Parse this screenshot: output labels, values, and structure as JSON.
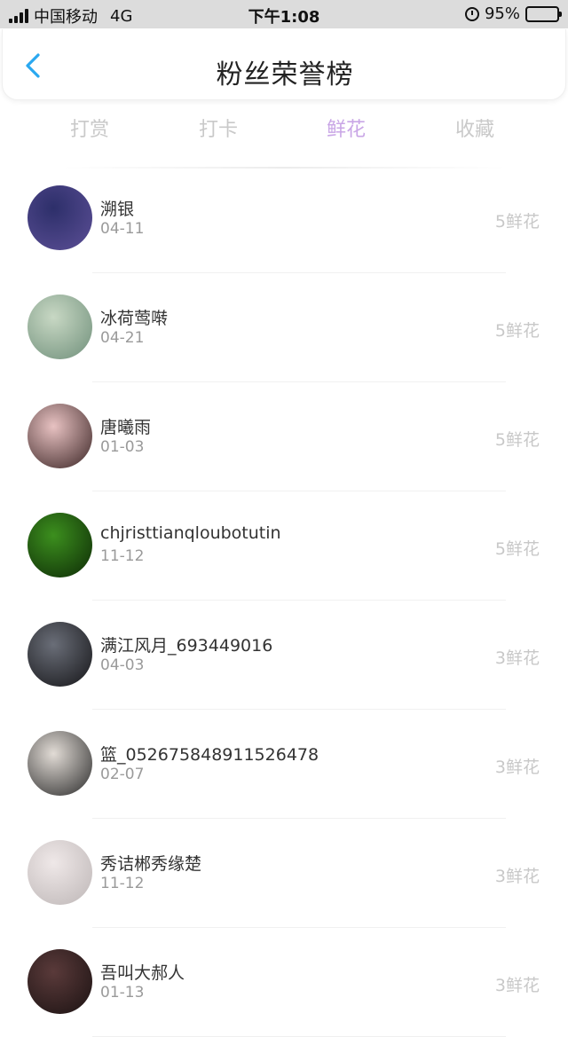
{
  "status_bar": {
    "carrier": "中国移动",
    "network": "4G",
    "time": "下午1:08",
    "battery_percent": "95%",
    "battery_level": 0.95
  },
  "nav": {
    "title": "粉丝荣誉榜",
    "back_icon": "chevron-left-icon",
    "accent_color": "#2aa8f0"
  },
  "tabs": [
    {
      "label": "打赏",
      "active": false
    },
    {
      "label": "打卡",
      "active": false
    },
    {
      "label": "鲜花",
      "active": true
    },
    {
      "label": "收藏",
      "active": false
    }
  ],
  "active_tab_color": "#c9a6e6",
  "fans": [
    {
      "name": "溯银",
      "date": "04-11",
      "count": "5鲜花",
      "avatar_colors": [
        "#2d2f6a",
        "#5c4f96"
      ]
    },
    {
      "name": "冰荷莺啭",
      "date": "04-21",
      "count": "5鲜花",
      "avatar_colors": [
        "#c8d8c4",
        "#6f8f7a"
      ]
    },
    {
      "name": "唐曦雨",
      "date": "01-03",
      "count": "5鲜花",
      "avatar_colors": [
        "#e8c2c2",
        "#3a2424"
      ]
    },
    {
      "name": "chjristtianqloubotutin",
      "date": "11-12",
      "count": "5鲜花",
      "avatar_colors": [
        "#3c8f1e",
        "#0d2a06"
      ]
    },
    {
      "name": "满江风月_693449016",
      "date": "04-03",
      "count": "3鲜花",
      "avatar_colors": [
        "#6a6e78",
        "#151518"
      ]
    },
    {
      "name": "篮_052675848911526478",
      "date": "02-07",
      "count": "3鲜花",
      "avatar_colors": [
        "#e2dcd6",
        "#2a2a2a"
      ]
    },
    {
      "name": "秀诘郴秀缘楚",
      "date": "11-12",
      "count": "3鲜花",
      "avatar_colors": [
        "#efe8e8",
        "#bdb6b6"
      ]
    },
    {
      "name": "吾叫大郝人",
      "date": "01-13",
      "count": "3鲜花",
      "avatar_colors": [
        "#5a3a3a",
        "#1b1212"
      ]
    }
  ]
}
